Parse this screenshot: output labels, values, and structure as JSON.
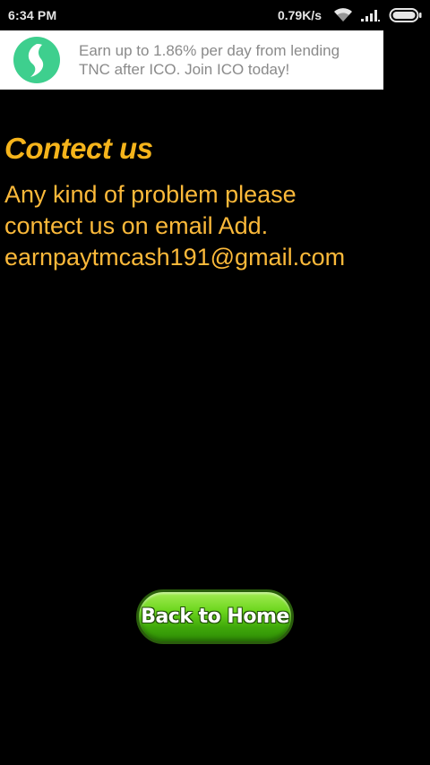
{
  "status_bar": {
    "time": "6:34 PM",
    "net_speed": "0.79K/s",
    "icons": [
      "wifi-icon",
      "signal-icon",
      "battery-icon"
    ]
  },
  "ad": {
    "line1": "Earn up to 1.86% per day from lending",
    "line2": "TNC after ICO. Join ICO today!",
    "logo_icon": "leaf-logo",
    "logo_color": "#3ecf8e"
  },
  "page": {
    "title": "Contect us",
    "message_lines": [
      "Any kind of problem please",
      "contect us on email Add.",
      "earnpaytmcash191@gmail.com"
    ],
    "title_color": "#f5b41b",
    "text_color": "#fbb93a"
  },
  "back_button": {
    "label": "Back to Home",
    "color": "#4fbf12"
  }
}
